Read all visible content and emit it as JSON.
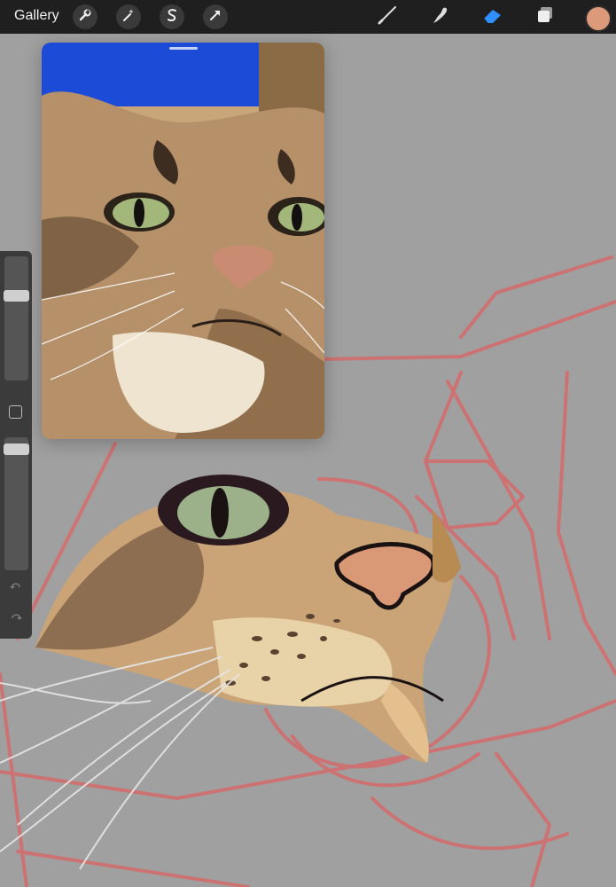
{
  "toolbar": {
    "gallery_label": "Gallery",
    "left_tools": [
      "wrench-icon",
      "magic-wand-icon",
      "selection-s-icon",
      "transform-arrow-icon"
    ],
    "right_tools": [
      "brush-icon",
      "smudge-icon",
      "eraser-icon",
      "layers-icon"
    ],
    "active_tool": "eraser-icon",
    "color": "#dd9a7a",
    "active_color": "#2f8fff"
  },
  "sidepanel": {
    "brush_size": 0.3,
    "brush_opacity": 0.05
  },
  "canvas": {
    "background": "#a0a0a0",
    "sketch_color": "#d66a6a"
  }
}
